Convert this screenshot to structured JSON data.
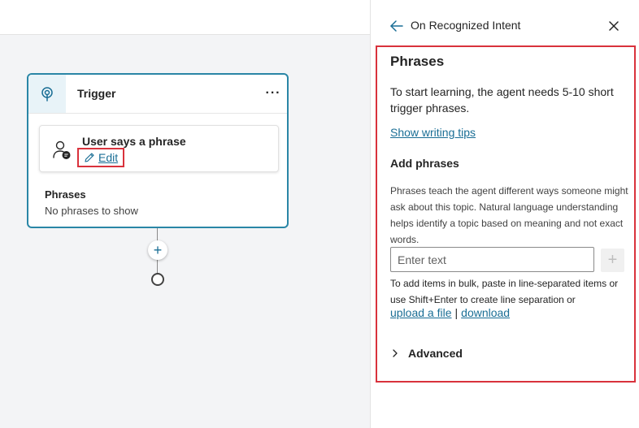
{
  "canvas": {
    "trigger": {
      "title": "Trigger",
      "more_label": "···",
      "phrase_card": {
        "title": "User says a phrase",
        "edit_label": "Edit"
      },
      "phrases_title": "Phrases",
      "phrases_empty": "No phrases to show"
    },
    "add_node_label": "+"
  },
  "panel": {
    "title": "On Recognized Intent",
    "phrases_heading": "Phrases",
    "intro": "To start learning, the agent needs 5-10 short trigger phrases.",
    "writing_tips_link": "Show writing tips",
    "add_phrases_heading": "Add phrases",
    "add_phrases_desc": "Phrases teach the agent different ways someone might ask about this topic. Natural language understanding helps identify a topic based on meaning and not exact words.",
    "input_placeholder": "Enter text",
    "add_button_label": "+",
    "bulk_hint": "To add items in bulk, paste in line-separated items or use Shift+Enter to create line separation or",
    "upload_link": "upload a file",
    "separator": "|",
    "download_link": "download",
    "advanced_label": "Advanced"
  },
  "colors": {
    "accent": "#1a6e95",
    "card_border": "#2a86a6",
    "highlight": "#d9323c"
  },
  "icons": {
    "trigger": "lightbulb-target-icon",
    "more": "more-horizontal-icon",
    "user": "person-chat-icon",
    "edit": "pencil-icon",
    "back": "arrow-left-icon",
    "close": "close-icon",
    "add": "plus-icon",
    "advanced": "chevron-right-icon"
  }
}
